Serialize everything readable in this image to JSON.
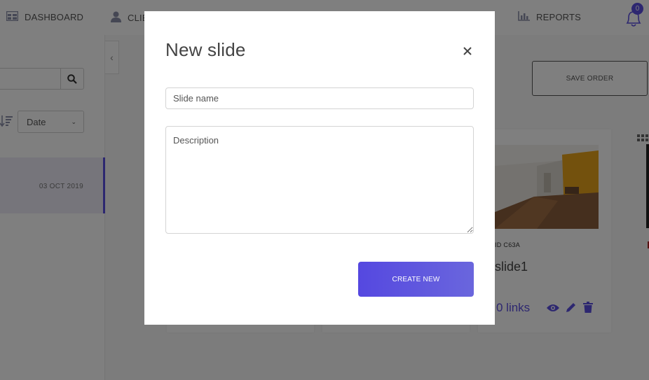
{
  "nav": {
    "dashboard_label": "DASHBOARD",
    "clients_label": "CLIE",
    "reports_label": "REPORTS",
    "notifications_count": "0"
  },
  "sidebar": {
    "sort_select_value": "Date",
    "items": [
      {
        "date": "03 OCT 2019"
      }
    ]
  },
  "toolbar": {
    "save_order_label": "SAVE ORDER"
  },
  "cards": [
    {
      "id_label": "ID C63A",
      "title": "slide1",
      "links_label": "0 links"
    }
  ],
  "modal": {
    "title": "New slide",
    "close_symbol": "×",
    "slide_name_placeholder": "Slide name",
    "description_placeholder": "Description",
    "create_label": "CREATE NEW"
  },
  "colors": {
    "accent": "#5a4ee0",
    "overlay": "rgba(0,0,0,0.5)"
  }
}
